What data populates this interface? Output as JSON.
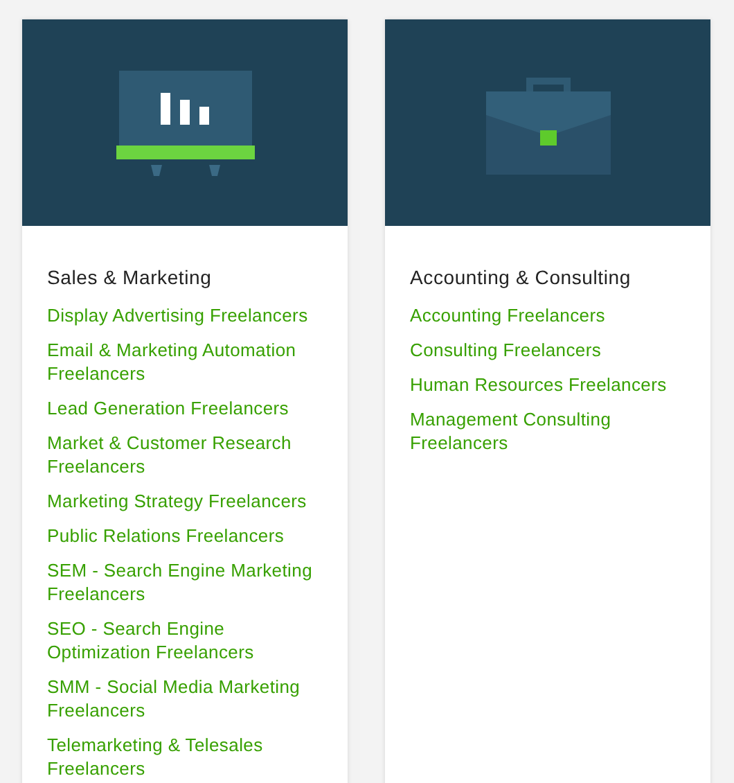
{
  "cards": [
    {
      "kind": "easel",
      "title": "Sales & Marketing",
      "links": [
        "Display Advertising Freelancers",
        "Email & Marketing Automation Freelancers",
        "Lead Generation Freelancers",
        "Market & Customer Research Freelancers",
        "Marketing Strategy Freelancers",
        "Public Relations Freelancers",
        "SEM - Search Engine Marketing Freelancers",
        "SEO - Search Engine Optimization Freelancers",
        "SMM - Social Media Marketing Freelancers",
        "Telemarketing & Telesales Freelancers"
      ]
    },
    {
      "kind": "briefcase",
      "title": "Accounting & Consulting",
      "links": [
        "Accounting Freelancers",
        "Consulting Freelancers",
        "Human Resources Freelancers",
        "Management Consulting Freelancers"
      ]
    }
  ]
}
